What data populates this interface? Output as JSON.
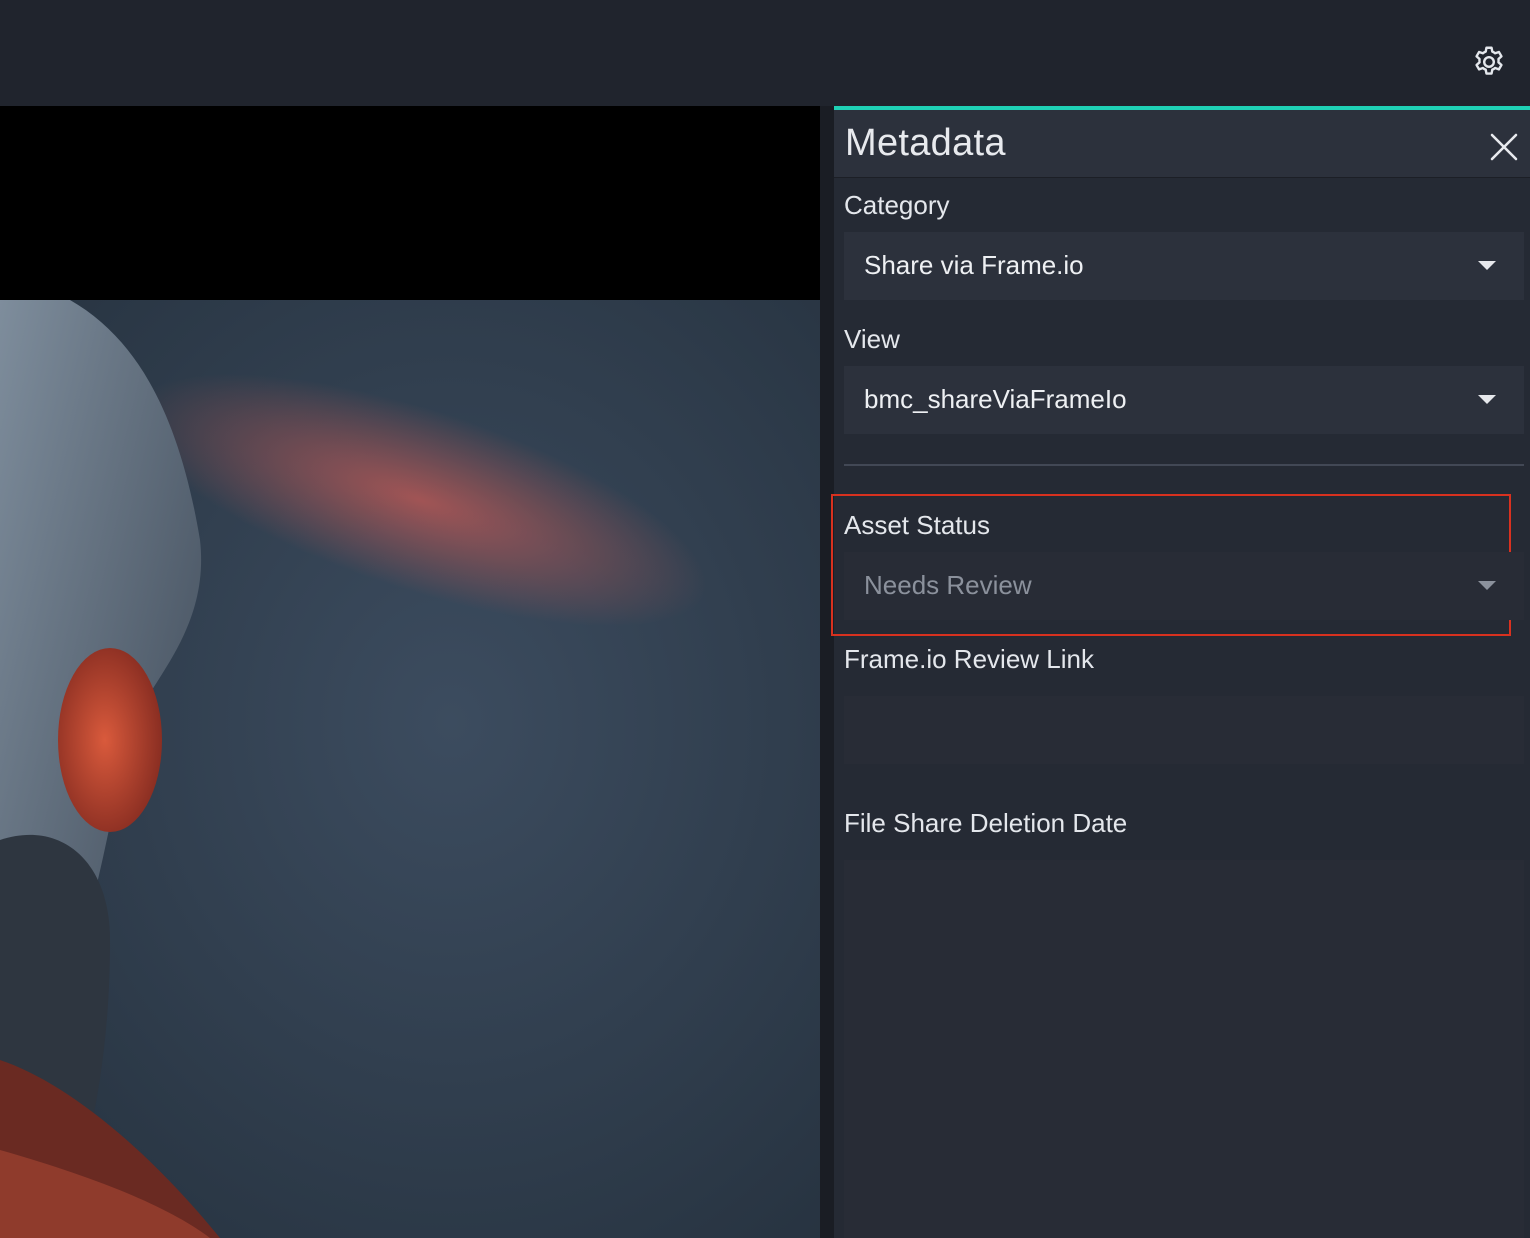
{
  "header": {
    "settings_icon": "gear-icon"
  },
  "panel": {
    "title": "Metadata",
    "close_icon": "close-icon",
    "accent_color": "#1fd1b5",
    "category": {
      "label": "Category",
      "value": "Share via Frame.io"
    },
    "view": {
      "label": "View",
      "value": "bmc_shareViaFrameIo"
    },
    "asset_status": {
      "label": "Asset Status",
      "value": "Needs Review",
      "highlight_color": "#d8311f"
    },
    "review_link": {
      "label": "Frame.io Review Link",
      "value": ""
    },
    "deletion_date": {
      "label": "File Share Deletion Date",
      "value": ""
    }
  }
}
